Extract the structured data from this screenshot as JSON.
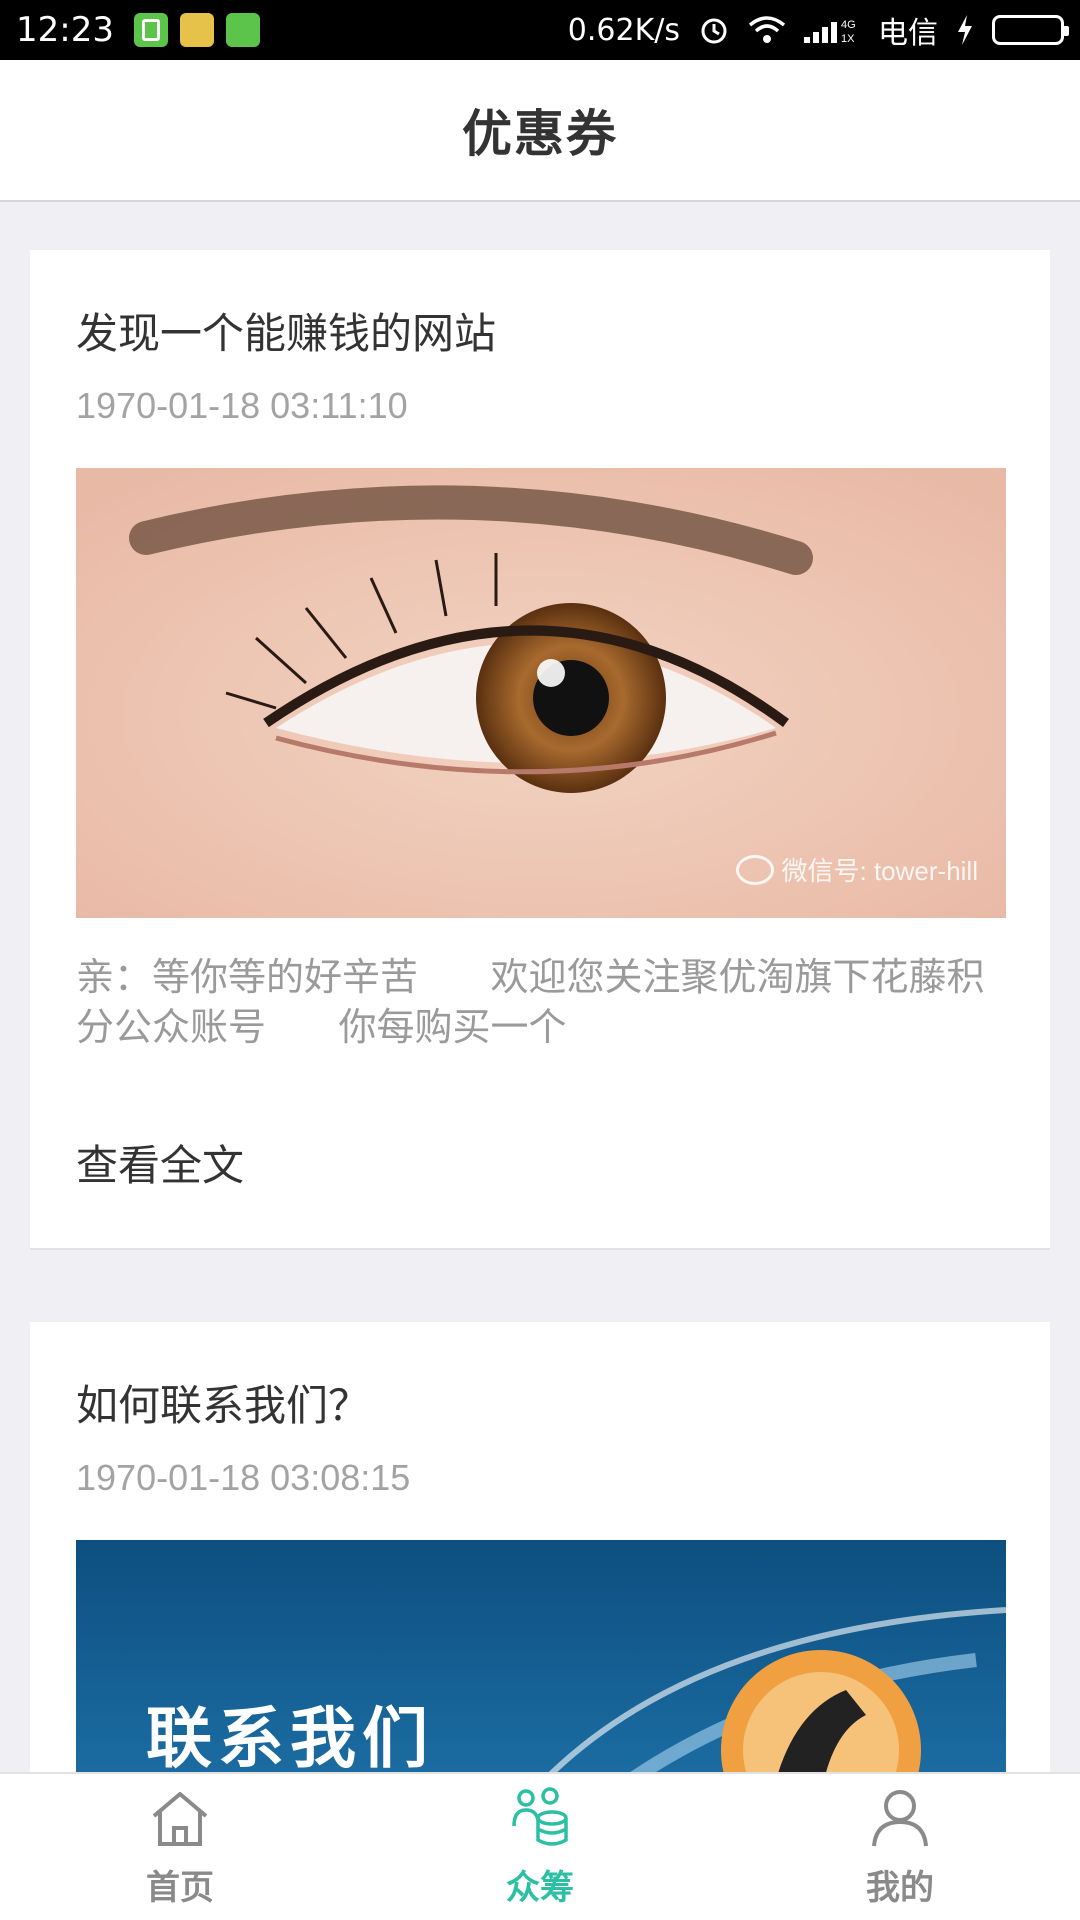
{
  "status_bar": {
    "time": "12:23",
    "network_speed": "0.62K/s",
    "network_type": "4G 1X",
    "carrier": "电信",
    "icons": [
      "battery-app-icon",
      "bunny-app-icon",
      "android-app-icon",
      "alarm-icon",
      "wifi-icon",
      "signal-icon",
      "charging-icon",
      "battery-icon"
    ]
  },
  "header": {
    "title": "优惠券"
  },
  "articles": [
    {
      "title": "发现一个能赚钱的网站",
      "date": "1970-01-18 03:11:10",
      "image_watermark": "微信号: tower-hill",
      "excerpt": "亲：等你等的好辛苦      欢迎您关注聚优淘旗下花藤积分公众账号      你每购买一个",
      "read_more": "查看全文"
    },
    {
      "title": "如何联系我们？",
      "date": "1970-01-18 03:08:15",
      "image_text": "联系我们"
    }
  ],
  "bottom_nav": {
    "items": [
      {
        "label": "首页",
        "icon": "home-icon",
        "active": false
      },
      {
        "label": "众筹",
        "icon": "crowdfunding-icon",
        "active": true
      },
      {
        "label": "我的",
        "icon": "profile-icon",
        "active": false
      }
    ]
  },
  "colors": {
    "accent": "#2bbfa4",
    "header_text": "#333333",
    "muted": "#a3a3a3",
    "background": "#f0f0f4"
  }
}
